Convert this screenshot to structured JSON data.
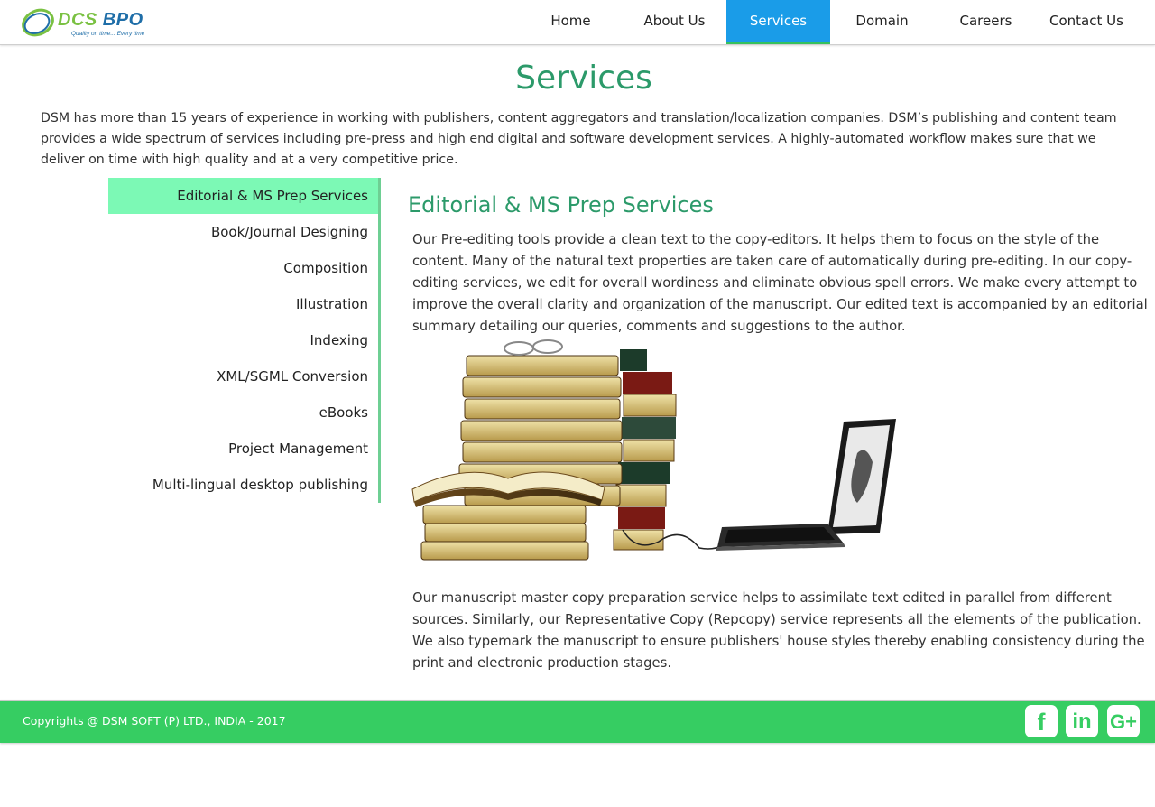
{
  "header": {
    "logo": {
      "name_part1": "DCS",
      "name_part2": "BPO",
      "tagline": "Quality on time... Every time"
    },
    "nav": [
      {
        "label": "Home"
      },
      {
        "label": "About Us"
      },
      {
        "label": "Services",
        "active": true
      },
      {
        "label": "Domain"
      },
      {
        "label": "Careers"
      },
      {
        "label": "Contact Us"
      }
    ]
  },
  "page": {
    "title": "Services",
    "intro": "DSM has more than 15 years of experience in working with publishers, content aggregators and translation/localization companies. DSM’s publishing and content team provides a wide spectrum of services including pre-press and high end digital and software development services. A highly-automated workflow makes sure that we deliver on time with high quality and at a very competitive price."
  },
  "sidebar": {
    "items": [
      {
        "label": "Editorial & MS Prep Services",
        "active": true
      },
      {
        "label": "Book/Journal Designing"
      },
      {
        "label": "Composition"
      },
      {
        "label": "Illustration"
      },
      {
        "label": "Indexing"
      },
      {
        "label": "XML/SGML Conversion"
      },
      {
        "label": "eBooks"
      },
      {
        "label": "Project Management"
      },
      {
        "label": "Multi-lingual desktop publishing"
      }
    ]
  },
  "content": {
    "title": "Editorial & MS Prep Services",
    "paragraph1": "Our Pre-editing tools provide a clean text to the copy-editors. It helps them to focus on the style of the content. Many of the natural text properties are taken care of automatically during pre-editing. In our copy-editing services, we edit for overall wordiness and eliminate obvious spell errors. We make every attempt to improve the overall clarity and organization of the manuscript. Our edited text is accompanied by an editorial summary detailing our queries, comments and suggestions to the author.",
    "paragraph2": "Our manuscript master copy preparation service helps to assimilate text edited in parallel from different sources. Similarly, our Representative Copy (Repcopy) service represents all the elements of the publication. We also typemark the manuscript to ensure publishers' house styles thereby enabling consistency during the print and electronic production stages."
  },
  "footer": {
    "copyright": "Copyrights @ DSM SOFT (P) LTD., INDIA - 2017",
    "social": [
      {
        "icon": "facebook-icon",
        "glyph": "f"
      },
      {
        "icon": "linkedin-icon",
        "glyph": "in"
      },
      {
        "icon": "google-plus-icon",
        "glyph": "G+"
      }
    ]
  },
  "colors": {
    "accent_green": "#2c9a6a",
    "nav_active": "#1a9ce8",
    "sidebar_active": "#7cf9b5",
    "footer_bg": "#36cd62"
  }
}
